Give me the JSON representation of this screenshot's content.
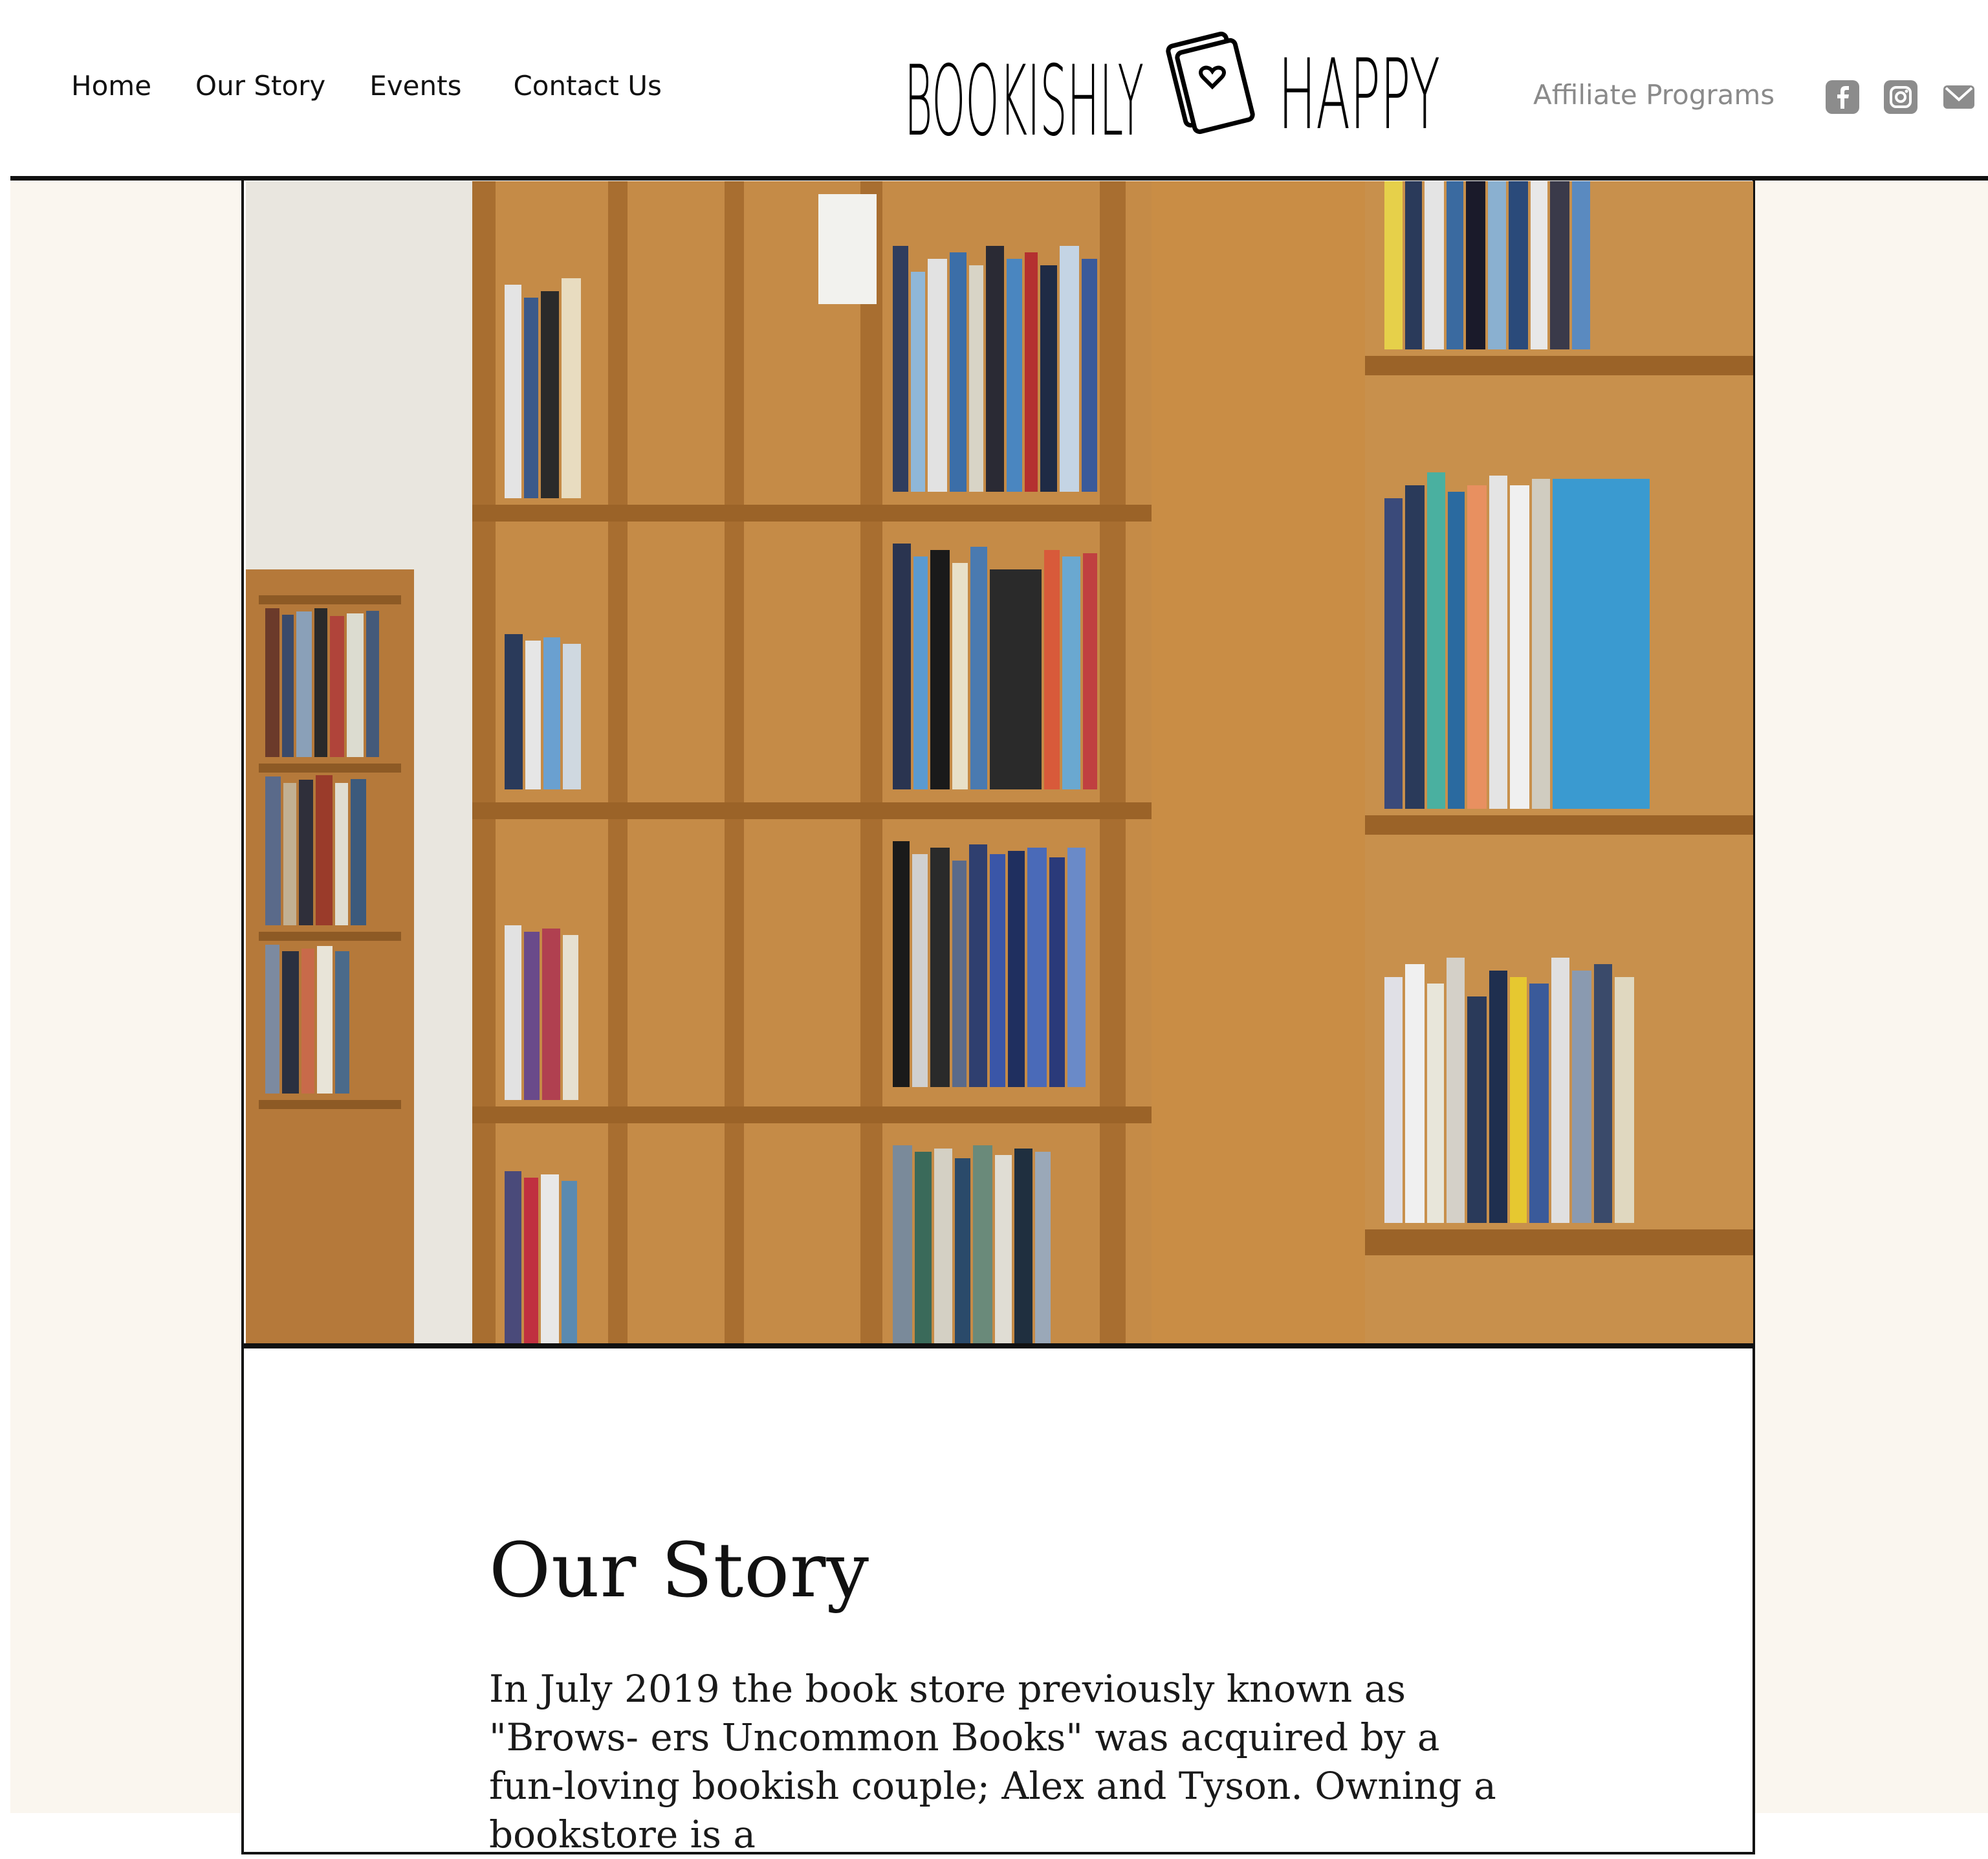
{
  "nav": {
    "items": [
      {
        "label": "Home"
      },
      {
        "label": "Our Story"
      },
      {
        "label": "Events"
      },
      {
        "label": "Contact Us"
      }
    ]
  },
  "logo": {
    "text_left": "BOOKISHLY",
    "text_right": "HAPPY"
  },
  "header": {
    "affiliate_label": "Affiliate Programs"
  },
  "social": {
    "icons": [
      "facebook-icon",
      "instagram-icon",
      "email-icon"
    ]
  },
  "hero": {
    "image": "bookshelves-photo"
  },
  "main": {
    "title": "Our Story",
    "body": "In July 2019 the book store previously known as \"Brows- ers Uncommon Books\" was acquired by a fun-loving bookish couple; Alex and Tyson. Owning a bookstore is a"
  },
  "colors": {
    "page_bg": "#faf6ef",
    "text": "#111111",
    "muted": "#8a8a8a",
    "icon": "#8c8c8c"
  }
}
